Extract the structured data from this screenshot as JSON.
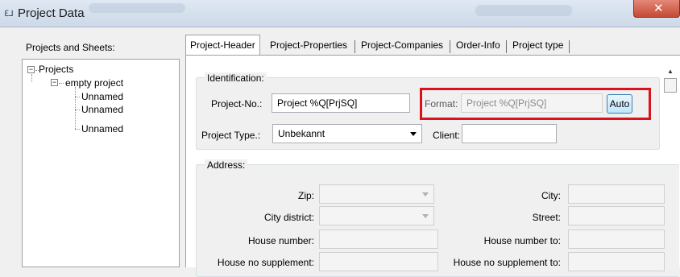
{
  "window": {
    "title": "Project Data",
    "close_glyph": "✕",
    "app_glyph": "ℇ⅃"
  },
  "left": {
    "label": "Projects and Sheets:",
    "tree": {
      "root": "Projects",
      "project": "empty project",
      "sheets": [
        "Unnamed",
        "Unnamed",
        "Unnamed"
      ],
      "collapse_glyph": "−"
    }
  },
  "tabs": [
    {
      "label": "Project-Header",
      "active": true
    },
    {
      "label": "Project-Properties"
    },
    {
      "label": "Project-Companies"
    },
    {
      "label": "Order-Info"
    },
    {
      "label": "Project type"
    }
  ],
  "identification": {
    "title": "Identification:",
    "project_no_label": "Project-No.:",
    "project_no_value": "Project %Q[PrjSQ]",
    "format_label": "Format:",
    "format_value": "Project %Q[PrjSQ]",
    "auto_label": "Auto",
    "project_type_label": "Project Type.:",
    "project_type_value": "Unbekannt",
    "client_label": "Client:",
    "client_value": ""
  },
  "address": {
    "title": "Address:",
    "zip_label": "Zip:",
    "city_label": "City:",
    "city_district_label": "City district:",
    "street_label": "Street:",
    "house_number_label": "House number:",
    "house_number_to_label": "House number to:",
    "house_no_supplement_label": "House no supplement:",
    "house_no_supplement_to_label": "House no supplement to:"
  },
  "scrollbar": {
    "up_glyph": "▲"
  },
  "colors": {
    "highlight": "#d9121d",
    "titlebar": "#dfe8f3",
    "close": "#c44a36"
  }
}
